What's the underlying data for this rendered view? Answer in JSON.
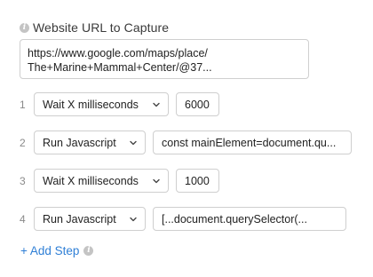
{
  "field": {
    "label": "Website URL to Capture",
    "url_line1": "https://www.google.com/maps/place/",
    "url_line2": "The+Marine+Mammal+Center/@37..."
  },
  "steps": [
    {
      "number": "1",
      "action": "Wait X milliseconds",
      "value": "6000"
    },
    {
      "number": "2",
      "action": "Run Javascript",
      "value": "const mainElement=document.qu..."
    },
    {
      "number": "3",
      "action": "Wait X milliseconds",
      "value": "1000"
    },
    {
      "number": "4",
      "action": "Run Javascript",
      "value": "[...document.querySelector(..."
    }
  ],
  "add_step_label": "+ Add Step",
  "info_glyph": "i",
  "colors": {
    "link": "#2f7fd6",
    "border": "#cfcfcf",
    "info_icon": "#c4c4c4"
  }
}
